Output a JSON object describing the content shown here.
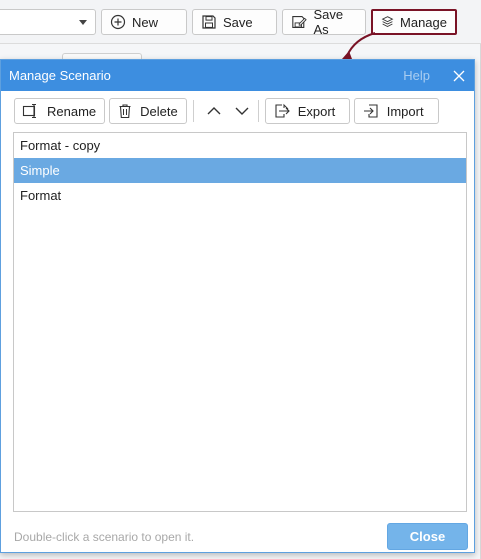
{
  "toolbar": {
    "new_label": "New",
    "save_label": "Save",
    "save_as_label": "Save As",
    "manage_label": "Manage"
  },
  "dialog": {
    "title": "Manage Scenario",
    "help_label": "Help",
    "toolbar": {
      "rename_label": "Rename",
      "delete_label": "Delete",
      "export_label": "Export",
      "import_label": "Import"
    },
    "scenarios": [
      {
        "label": "Format - copy",
        "selected": false
      },
      {
        "label": "Simple",
        "selected": true
      },
      {
        "label": "Format",
        "selected": false
      }
    ],
    "hint": "Double-click a scenario to open it.",
    "close_label": "Close"
  },
  "colors": {
    "titlebar": "#3d8ee0",
    "selection": "#6aa9e2",
    "highlight_border": "#7a1326",
    "close_button": "#74b4ea"
  },
  "icons": [
    "plus-circle-icon",
    "save-icon",
    "save-as-icon",
    "layers-icon",
    "rename-icon",
    "trash-icon",
    "chevron-up-icon",
    "chevron-down-icon",
    "export-icon",
    "import-icon",
    "close-icon"
  ]
}
